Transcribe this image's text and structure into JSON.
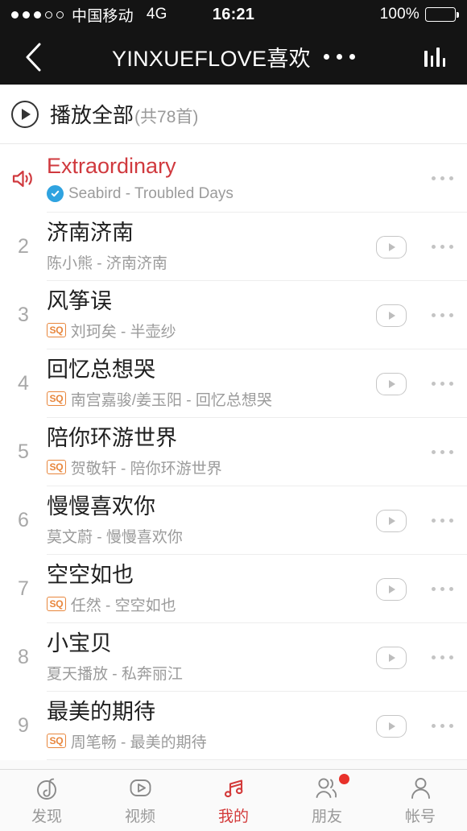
{
  "status_bar": {
    "signal_filled": 3,
    "signal_hollow": 2,
    "carrier": "中国移动",
    "network": "4G",
    "time": "16:21",
    "battery_percent": "100%",
    "battery_level": 100
  },
  "nav": {
    "back_icon": "chevron-left-icon",
    "title": "YINXUEFLOVE喜欢",
    "more_icon": "more-horizontal-icon",
    "eq_icon": "equalizer-icon"
  },
  "play_all": {
    "icon": "play-circle-icon",
    "label": "播放全部",
    "count": "(共78首)"
  },
  "songs": [
    {
      "index": "1",
      "playing": true,
      "playing_icon": "speaker-wave-icon",
      "title": "Extraordinary",
      "verified": true,
      "sq": false,
      "subtitle": "Seabird - Troubled Days",
      "mv": false,
      "more_icon": "more-horizontal-icon"
    },
    {
      "index": "2",
      "playing": false,
      "title": "济南济南",
      "verified": false,
      "sq": false,
      "subtitle": "陈小熊 - 济南济南",
      "mv": true,
      "more_icon": "more-horizontal-icon"
    },
    {
      "index": "3",
      "playing": false,
      "title": "风筝误",
      "verified": false,
      "sq": true,
      "sq_label": "SQ",
      "subtitle": "刘珂矣 - 半壶纱",
      "mv": true,
      "more_icon": "more-horizontal-icon"
    },
    {
      "index": "4",
      "playing": false,
      "title": "回忆总想哭",
      "verified": false,
      "sq": true,
      "sq_label": "SQ",
      "subtitle": "南宫嘉骏/姜玉阳 - 回忆总想哭",
      "mv": true,
      "more_icon": "more-horizontal-icon"
    },
    {
      "index": "5",
      "playing": false,
      "title": "陪你环游世界",
      "verified": false,
      "sq": true,
      "sq_label": "SQ",
      "subtitle": "贺敬轩 - 陪你环游世界",
      "mv": false,
      "more_icon": "more-horizontal-icon"
    },
    {
      "index": "6",
      "playing": false,
      "title": "慢慢喜欢你",
      "verified": false,
      "sq": false,
      "subtitle": "莫文蔚 - 慢慢喜欢你",
      "mv": true,
      "more_icon": "more-horizontal-icon"
    },
    {
      "index": "7",
      "playing": false,
      "title": "空空如也",
      "verified": false,
      "sq": true,
      "sq_label": "SQ",
      "subtitle": "任然 - 空空如也",
      "mv": true,
      "more_icon": "more-horizontal-icon"
    },
    {
      "index": "8",
      "playing": false,
      "title": "小宝贝",
      "verified": false,
      "sq": false,
      "subtitle": "夏天播放 - 私奔丽江",
      "mv": true,
      "more_icon": "more-horizontal-icon"
    },
    {
      "index": "9",
      "playing": false,
      "title": "最美的期待",
      "verified": false,
      "sq": true,
      "sq_label": "SQ",
      "subtitle": "周笔畅 - 最美的期待",
      "mv": true,
      "more_icon": "more-horizontal-icon"
    }
  ],
  "tabs": [
    {
      "key": "discover",
      "icon": "netease-music-logo-icon",
      "label": "发现",
      "active": false,
      "badge": false
    },
    {
      "key": "video",
      "icon": "video-play-icon",
      "label": "视频",
      "active": false,
      "badge": false
    },
    {
      "key": "mine",
      "icon": "music-note-icon",
      "label": "我的",
      "active": true,
      "badge": false
    },
    {
      "key": "friends",
      "icon": "friends-icon",
      "label": "朋友",
      "active": false,
      "badge": true
    },
    {
      "key": "account",
      "icon": "person-icon",
      "label": "帐号",
      "active": false,
      "badge": false
    }
  ],
  "colors": {
    "accent_red": "#d33a3a",
    "playing_red": "#d0393e",
    "sq_orange": "#e8863c",
    "verified_blue": "#2fa3e0",
    "bar_black": "#141414"
  }
}
